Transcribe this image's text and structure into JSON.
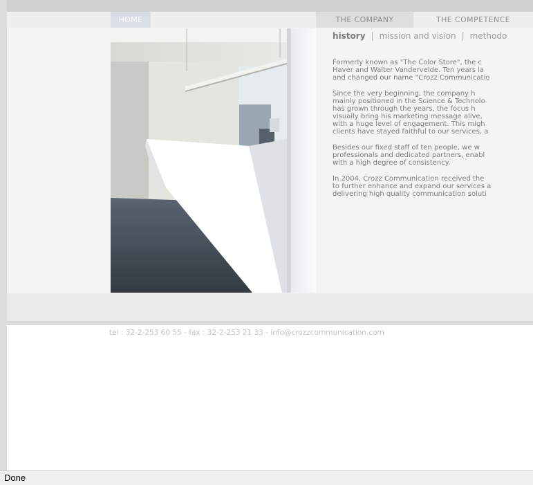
{
  "nav": {
    "home": "HOME",
    "company": "THE COMPANY",
    "competence": "THE COMPETENCE"
  },
  "subnav": {
    "history": "history",
    "sep": "|",
    "mission": "mission and vision",
    "methodology": "methodo"
  },
  "article": {
    "p1": [
      "Formerly known as \"The Color Store\", the c",
      "Haver and Walter Vandervelde. Ten years la",
      "and changed our name \"Crozz Communicatio"
    ],
    "p2": [
      "Since the very beginning, the company h",
      "mainly positioned in the Science & Technolo",
      "has grown through the years, the focus h",
      "visually bring his marketing message alive,",
      "with a huge level of engagement. This migh",
      "clients have stayed faithful to our services, a"
    ],
    "p3": [
      "Besides our fixed staff of ten people, we w",
      "professionals and dedicated partners, enabl",
      "with a high degree of consistency."
    ],
    "p4": [
      "In 2004, Crozz Communication received the",
      "to further enhance and expand our services a",
      "delivering high quality communication soluti"
    ]
  },
  "footer": {
    "contact": "tel : 32-2-253 60 55 - fax : 32-2-253 21 33 - info@crozzcommunication.com"
  },
  "status": {
    "text": "Done"
  },
  "colors": {
    "nav_active": "#d8dde6",
    "text": "#7c7c7c"
  }
}
